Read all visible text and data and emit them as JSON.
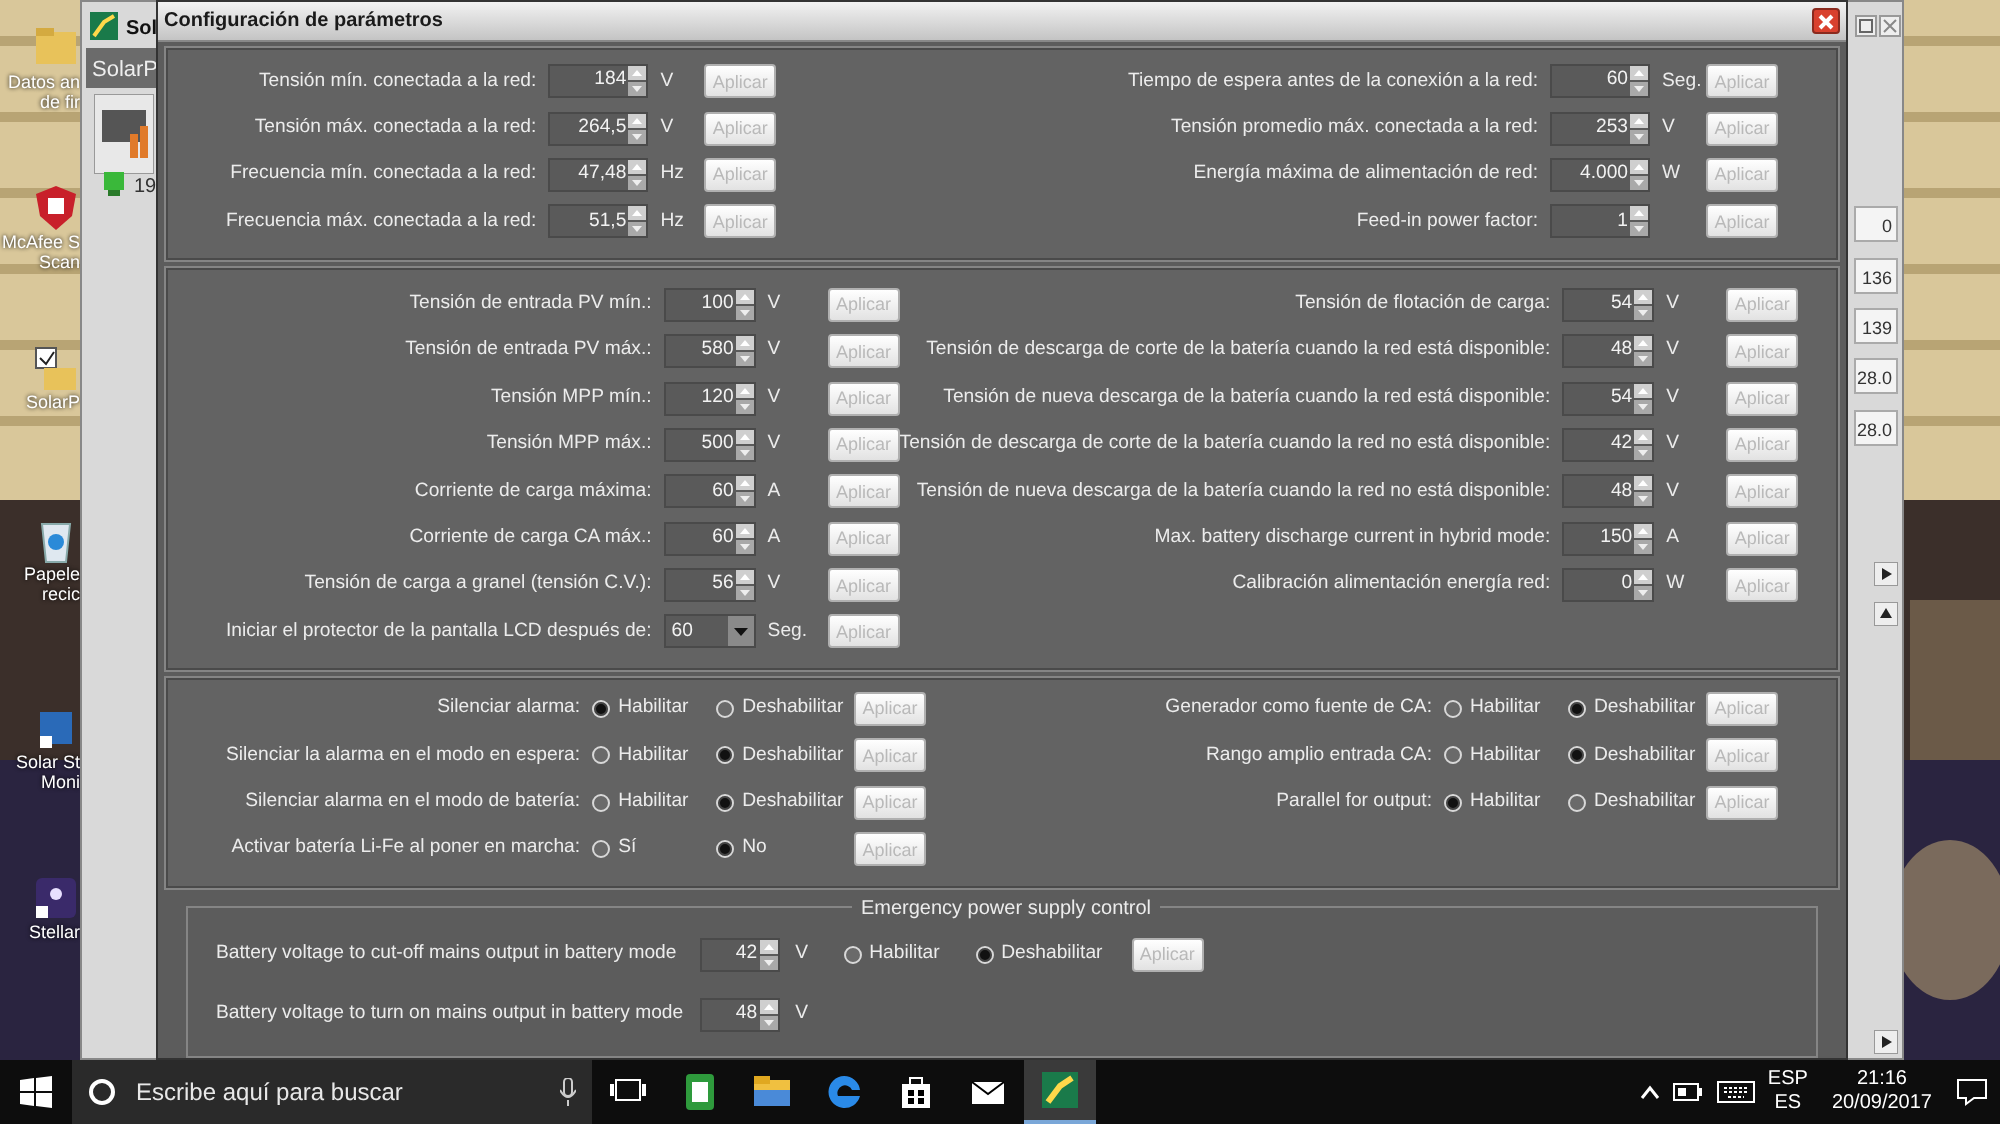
{
  "desktop_icons": [
    {
      "label": "Datos an de fir"
    },
    {
      "label": "McAfee S Scan"
    },
    {
      "label": "SolarP"
    },
    {
      "label": "Papele recic"
    },
    {
      "label": "Solar St Moni"
    },
    {
      "label": "Stellar"
    }
  ],
  "background_window": {
    "title": "Sol",
    "tab": "SolarP",
    "row": "19",
    "readings": [
      "0",
      "136",
      "139",
      "28.0",
      "28.0"
    ]
  },
  "dialog": {
    "title": "Configuración de parámetros",
    "sections": [
      {
        "left": [
          {
            "kind": "spin",
            "label": "Tensión mín. conectada a la red:",
            "value": "184",
            "unit": "V",
            "button": {
              "label": "Aplicar",
              "disabled": true
            }
          },
          {
            "kind": "spin",
            "label": "Tensión máx. conectada a la red:",
            "value": "264,5",
            "unit": "V",
            "button": {
              "label": "Aplicar",
              "disabled": true
            }
          },
          {
            "kind": "spin",
            "label": "Frecuencia mín. conectada a la red:",
            "value": "47,48",
            "unit": "Hz",
            "button": {
              "label": "Aplicar",
              "disabled": true
            }
          },
          {
            "kind": "spin",
            "label": "Frecuencia máx. conectada a la red:",
            "value": "51,5",
            "unit": "Hz",
            "button": {
              "label": "Aplicar",
              "disabled": true
            }
          }
        ],
        "right": [
          {
            "kind": "spin",
            "label": "Tiempo de espera antes de la conexión a la red:",
            "value": "60",
            "unit": "Seg.",
            "button": {
              "label": "Aplicar",
              "disabled": true
            }
          },
          {
            "kind": "spin",
            "label": "Tensión promedio máx. conectada a la red:",
            "value": "253",
            "unit": "V",
            "button": {
              "label": "Aplicar",
              "disabled": true
            }
          },
          {
            "kind": "spin",
            "label": "Energía máxima de alimentación de red:",
            "value": "4.000",
            "unit": "W",
            "button": {
              "label": "Aplicar",
              "disabled": true
            }
          },
          {
            "kind": "spin",
            "label": "Feed-in power factor:",
            "value": "1",
            "button": {
              "label": "Aplicar",
              "disabled": true
            }
          }
        ]
      },
      {
        "left": [
          {
            "kind": "spin",
            "label": "Tensión de entrada PV mín.:",
            "value": "100",
            "unit": "V",
            "button": {
              "label": "Aplicar",
              "disabled": true
            }
          },
          {
            "kind": "spin",
            "label": "Tensión de entrada PV máx.:",
            "value": "580",
            "unit": "V",
            "button": {
              "label": "Aplicar",
              "disabled": true
            }
          },
          {
            "kind": "spin",
            "label": "Tensión MPP mín.:",
            "value": "120",
            "unit": "V",
            "button": {
              "label": "Aplicar",
              "disabled": true
            }
          },
          {
            "kind": "spin",
            "label": "Tensión MPP máx.:",
            "value": "500",
            "unit": "V",
            "button": {
              "label": "Aplicar",
              "disabled": true
            }
          },
          {
            "kind": "spin",
            "label": "Corriente de carga máxima:",
            "value": "60",
            "unit": "A",
            "button": {
              "label": "Aplicar",
              "disabled": true
            }
          },
          {
            "kind": "spin",
            "label": "Corriente de carga CA máx.:",
            "value": "60",
            "unit": "A",
            "button": {
              "label": "Aplicar",
              "disabled": true
            }
          },
          {
            "kind": "spin",
            "label": "Tensión de carga a granel (tensión C.V.):",
            "value": "56",
            "unit": "V",
            "button": {
              "label": "Aplicar",
              "disabled": true
            }
          },
          {
            "kind": "dropdown",
            "label": "Iniciar el protector de la pantalla LCD después de:",
            "value": "60",
            "unit": "Seg.",
            "button": {
              "label": "Aplicar",
              "disabled": true
            }
          }
        ],
        "right": [
          {
            "kind": "spin",
            "label": "Tensión de flotación de carga:",
            "value": "54",
            "unit": "V",
            "button": {
              "label": "Aplicar",
              "disabled": true
            }
          },
          {
            "kind": "spin",
            "label": "Tensión de descarga de corte de la batería cuando la red está disponible:",
            "value": "48",
            "unit": "V",
            "button": {
              "label": "Aplicar",
              "disabled": true
            }
          },
          {
            "kind": "spin",
            "label": "Tensión de nueva descarga de la batería cuando la red está disponible:",
            "value": "54",
            "unit": "V",
            "button": {
              "label": "Aplicar",
              "disabled": true
            }
          },
          {
            "kind": "spin",
            "label": "Tensión de descarga de corte de la batería cuando la red no está disponible:",
            "value": "42",
            "unit": "V",
            "button": {
              "label": "Aplicar",
              "disabled": true
            }
          },
          {
            "kind": "spin",
            "label": "Tensión de nueva descarga de la batería cuando la red no está disponible:",
            "value": "48",
            "unit": "V",
            "button": {
              "label": "Aplicar",
              "disabled": true
            }
          },
          {
            "kind": "spin",
            "label": "Max. battery discharge current in hybrid mode:",
            "value": "150",
            "unit": "A",
            "button": {
              "label": "Aplicar",
              "disabled": true
            }
          },
          {
            "kind": "spin",
            "label": "Calibración alimentación energía red:",
            "value": "0",
            "unit": "W",
            "button": {
              "label": "Aplicar",
              "disabled": true
            }
          }
        ]
      },
      {
        "left": [
          {
            "kind": "radio",
            "label": "Silenciar alarma:",
            "options": [
              {
                "label": "Habilitar",
                "selected": true
              },
              {
                "label": "Deshabilitar",
                "selected": false
              }
            ],
            "button": {
              "label": "Aplicar",
              "disabled": true
            }
          },
          {
            "kind": "radio",
            "label": "Silenciar la alarma en el modo en espera:",
            "options": [
              {
                "label": "Habilitar",
                "selected": false
              },
              {
                "label": "Deshabilitar",
                "selected": true
              }
            ],
            "button": {
              "label": "Aplicar",
              "disabled": true
            }
          },
          {
            "kind": "radio",
            "label": "Silenciar alarma en el modo de batería:",
            "options": [
              {
                "label": "Habilitar",
                "selected": false
              },
              {
                "label": "Deshabilitar",
                "selected": true
              }
            ],
            "button": {
              "label": "Aplicar",
              "disabled": true
            }
          },
          {
            "kind": "radio",
            "label": "Activar batería Li-Fe al poner en marcha:",
            "options": [
              {
                "label": "Sí",
                "selected": false
              },
              {
                "label": "No",
                "selected": true
              }
            ],
            "button": {
              "label": "Aplicar",
              "disabled": true
            }
          }
        ],
        "right": [
          {
            "kind": "radio",
            "label": "Generador como fuente de CA:",
            "options": [
              {
                "label": "Habilitar",
                "selected": false
              },
              {
                "label": "Deshabilitar",
                "selected": true
              }
            ],
            "button": {
              "label": "Aplicar",
              "disabled": true
            }
          },
          {
            "kind": "radio",
            "label": "Rango amplio entrada CA:",
            "options": [
              {
                "label": "Habilitar",
                "selected": false
              },
              {
                "label": "Deshabilitar",
                "selected": true
              }
            ],
            "button": {
              "label": "Aplicar",
              "disabled": true
            }
          },
          {
            "kind": "radio",
            "label": "Parallel for output:",
            "options": [
              {
                "label": "Habilitar",
                "selected": true
              },
              {
                "label": "Deshabilitar",
                "selected": false
              }
            ],
            "button": {
              "label": "Aplicar",
              "disabled": true
            }
          }
        ]
      }
    ],
    "emergency": {
      "title": "Emergency power supply control",
      "rows": [
        {
          "kind": "spin",
          "label": "Battery voltage to cut-off mains output in battery mode",
          "value": "42",
          "unit": "V",
          "options": [
            {
              "label": "Habilitar",
              "selected": false
            },
            {
              "label": "Deshabilitar",
              "selected": true
            }
          ],
          "button": {
            "label": "Aplicar",
            "disabled": true
          }
        },
        {
          "kind": "spin",
          "label": "Battery voltage to turn on mains output in battery mode",
          "value": "48",
          "unit": "V"
        }
      ]
    }
  },
  "taskbar": {
    "search_placeholder": "Escribe aquí para buscar",
    "language": "ESP",
    "layout": "ES",
    "time": "21:16",
    "date": "20/09/2017"
  }
}
